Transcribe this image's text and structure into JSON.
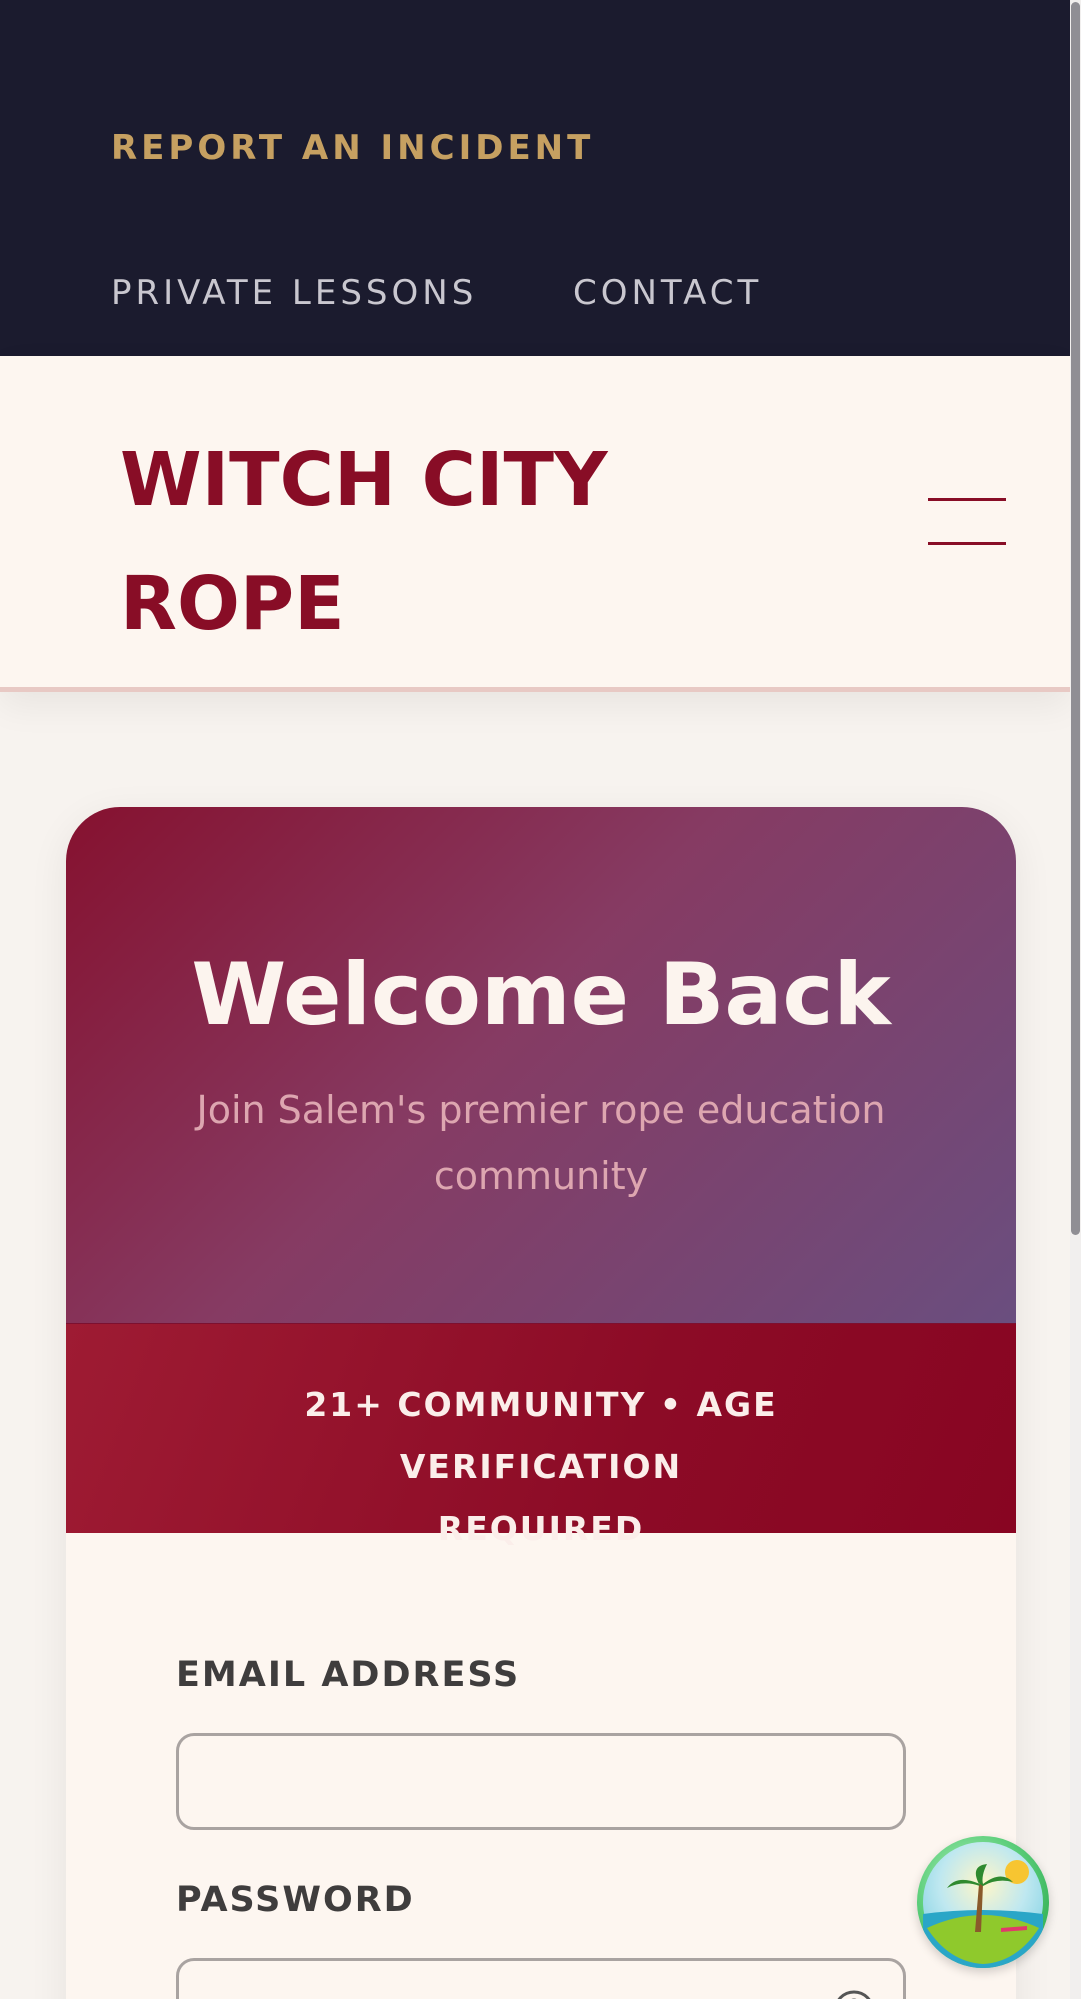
{
  "utility_nav": {
    "report_label": "REPORT AN INCIDENT",
    "lessons_label": "PRIVATE LESSONS",
    "contact_label": "CONTACT"
  },
  "header": {
    "brand_line1": "WITCH CITY",
    "brand_line2": "ROPE",
    "menu_icon": "hamburger-menu-icon"
  },
  "card": {
    "title": "Welcome Back",
    "subtitle_line1": "Join Salem's premier rope education",
    "subtitle_line2": "community",
    "age_notice_line1": "21+ COMMUNITY • AGE VERIFICATION",
    "age_notice_line2": "REQUIRED"
  },
  "form": {
    "email_label": "EMAIL ADDRESS",
    "email_value": "",
    "password_label": "PASSWORD",
    "password_value": "",
    "password_toggle_icon": "eye-icon"
  },
  "floating_badge": {
    "icon": "tropical-island-icon"
  },
  "colors": {
    "utility_bg": "#1b1b2e",
    "accent_gold": "#c6a061",
    "brand_burgundy": "#880d26",
    "header_bg": "#fdf6f0",
    "page_bg": "#f7f3ef"
  }
}
